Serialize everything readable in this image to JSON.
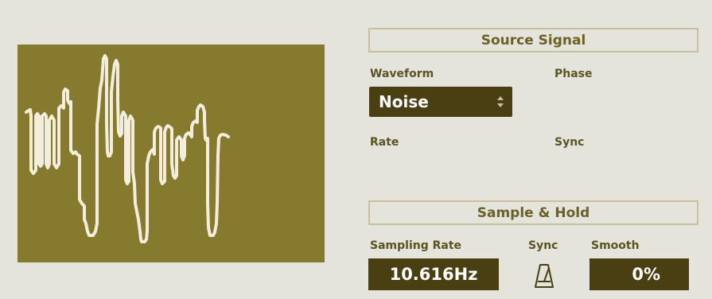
{
  "source_signal": {
    "title": "Source Signal",
    "waveform_label": "Waveform",
    "waveform_value": "Noise",
    "phase_label": "Phase",
    "rate_label": "Rate",
    "sync_label": "Sync"
  },
  "sample_hold": {
    "title": "Sample & Hold",
    "sampling_rate_label": "Sampling Rate",
    "sampling_rate_value": "10.616Hz",
    "sync_label": "Sync",
    "smooth_label": "Smooth",
    "smooth_value": "0%"
  },
  "icons": {
    "select_arrows": "up-down-arrows-icon",
    "sync": "metronome-icon"
  },
  "colors": {
    "background": "#e4e3dc",
    "scope_background": "#857a2e",
    "waveform_line": "#f2eddc",
    "control_background": "#4a3f13",
    "label_text": "#5c5420",
    "header_border": "#c7c09a"
  }
}
